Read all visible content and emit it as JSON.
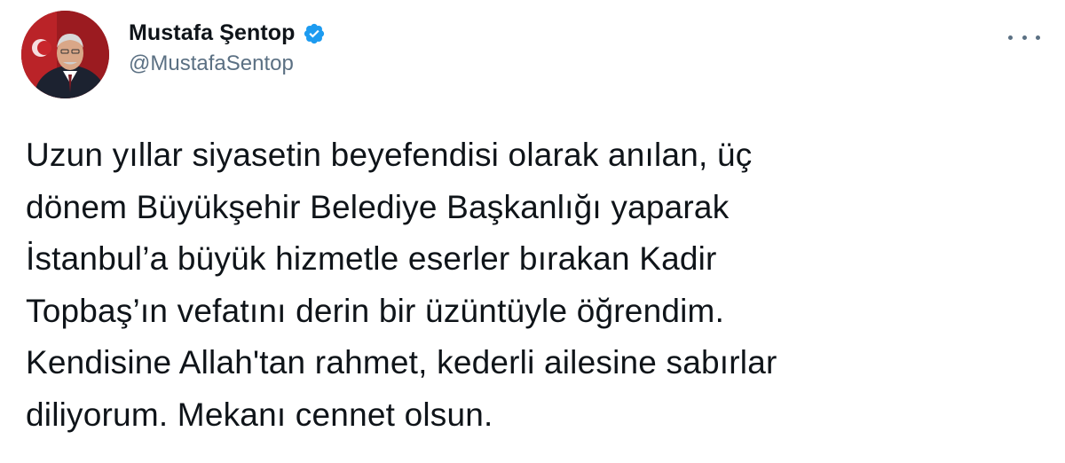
{
  "author": {
    "display_name": "Mustafa Şentop",
    "handle": "@MustafaSentop",
    "verified": true,
    "avatar_icon": "profile-photo",
    "verified_icon": "verified-badge-icon"
  },
  "more_icon": "more-options-icon",
  "tweet": {
    "lines": [
      "Uzun yıllar siyasetin beyefendisi olarak anılan, üç",
      "dönem Büyükşehir Belediye Başkanlığı yaparak",
      "İstanbul’a büyük hizmetle eserler bırakan Kadir",
      "Topbaş’ın vefatını derin bir üzüntüyle öğrendim.",
      "Kendisine Allah'tan rahmet, kederli ailesine sabırlar",
      "diliyorum. Mekanı cennet olsun."
    ]
  },
  "colors": {
    "text": "#0f1419",
    "secondary": "#5b7083",
    "verified": "#1d9bf0",
    "avatar_bg": "#8a1a1e"
  }
}
